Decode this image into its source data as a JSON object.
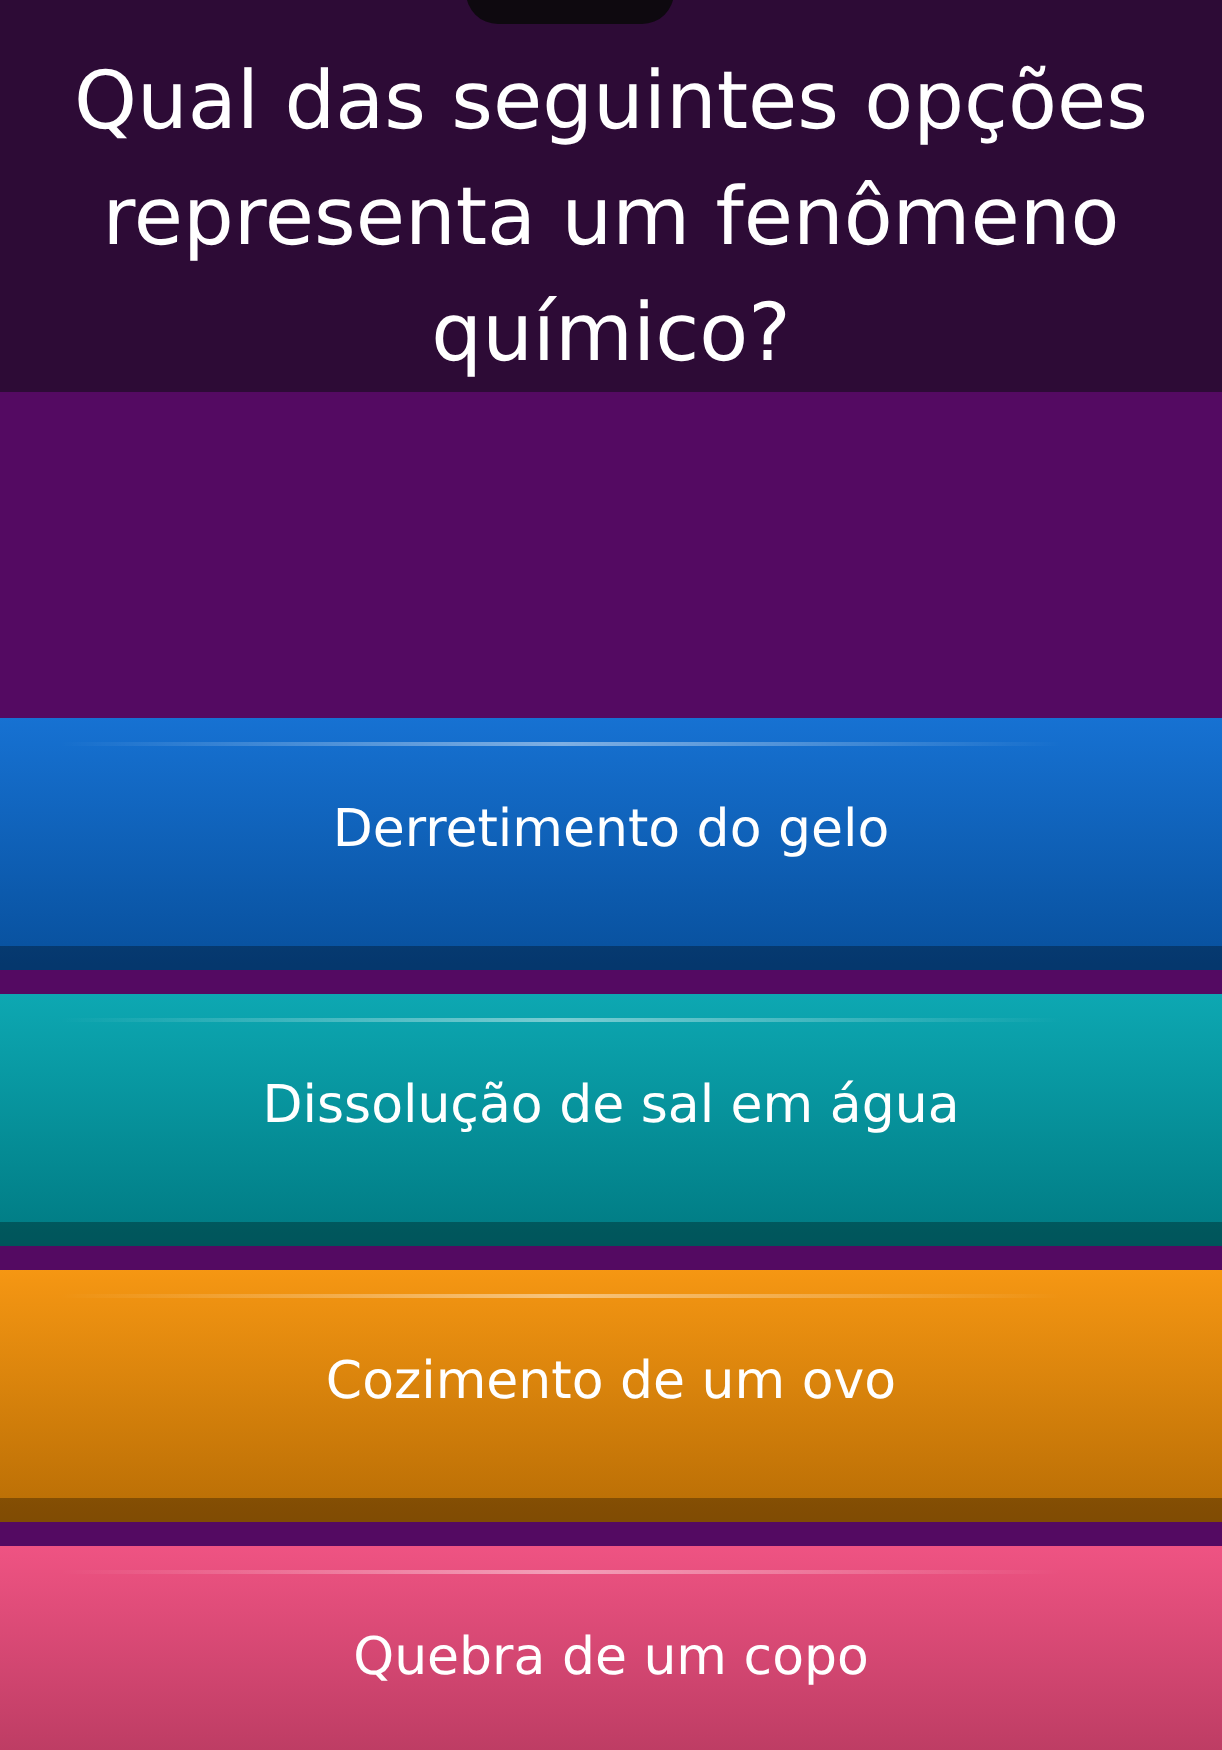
{
  "question": "Qual das seguintes opções representa um fenômeno químico?",
  "answers": [
    {
      "text": "Derretimento do gelo",
      "color": "#0a6ad0"
    },
    {
      "text": "Dissolução de sal em água",
      "color": "#00a3ae"
    },
    {
      "text": "Cozimento de um ovo",
      "color": "#f59106"
    },
    {
      "text": "Quebra de um copo",
      "color": "#ee4a7c"
    }
  ]
}
